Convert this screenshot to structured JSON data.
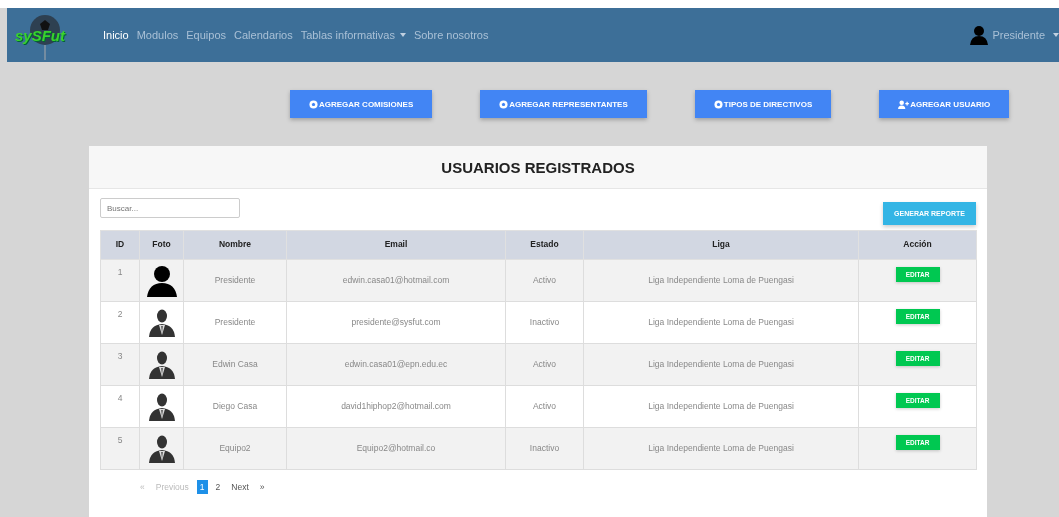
{
  "navbar": {
    "logo_text": "sySFut",
    "links": [
      {
        "label": "Inicio",
        "selected": true,
        "dropdown": false
      },
      {
        "label": "Modulos",
        "selected": false,
        "dropdown": false
      },
      {
        "label": "Equipos",
        "selected": false,
        "dropdown": false
      },
      {
        "label": "Calendarios",
        "selected": false,
        "dropdown": false
      },
      {
        "label": "Tablas informativas",
        "selected": false,
        "dropdown": true
      },
      {
        "label": "Sobre nosotros",
        "selected": false,
        "dropdown": false
      }
    ],
    "user": {
      "label": "Presidente"
    }
  },
  "actions": [
    {
      "label": "AGREGAR COMISIONES",
      "kind": "ball"
    },
    {
      "label": "AGREGAR REPRESENTANTES",
      "kind": "ball"
    },
    {
      "label": "TIPOS DE DIRECTIVOS",
      "kind": "ball"
    },
    {
      "label": "AGREGAR USUARIO",
      "kind": "adduser"
    }
  ],
  "card": {
    "title": "USUARIOS REGISTRADOS",
    "search": {
      "placeholder": "Buscar..."
    },
    "report_button": "GENERAR REPORTE",
    "table": {
      "columns": [
        "ID",
        "Foto",
        "Nombre",
        "Email",
        "Estado",
        "Liga",
        "Acción"
      ],
      "rows": [
        {
          "id": "1",
          "kind": "person",
          "name": "Presidente",
          "email": "edwin.casa01@hotmail.com",
          "status": "Activo",
          "league": "Liga Independiente Loma de Puengasi",
          "action": "EDITAR"
        },
        {
          "id": "2",
          "kind": "suit",
          "name": "Presidente",
          "email": "presidente@sysfut.com",
          "status": "Inactivo",
          "league": "Liga Independiente Loma de Puengasi",
          "action": "EDITAR"
        },
        {
          "id": "3",
          "kind": "suit",
          "name": "Edwin Casa",
          "email": "edwin.casa01@epn.edu.ec",
          "status": "Activo",
          "league": "Liga Independiente Loma de Puengasi",
          "action": "EDITAR"
        },
        {
          "id": "4",
          "kind": "suit",
          "name": "Diego Casa",
          "email": "david1hiphop2@hotmail.com",
          "status": "Activo",
          "league": "Liga Independiente Loma de Puengasi",
          "action": "EDITAR"
        },
        {
          "id": "5",
          "kind": "suit",
          "name": "Equipo2",
          "email": "Equipo2@hotmail.co",
          "status": "Inactivo",
          "league": "Liga Independiente Loma de Puengasi",
          "action": "EDITAR"
        }
      ]
    },
    "pagination": [
      {
        "label": "«",
        "selected": false,
        "disabled": true
      },
      {
        "label": "Previous",
        "selected": false,
        "disabled": true
      },
      {
        "label": "1",
        "selected": true,
        "disabled": false
      },
      {
        "label": "2",
        "selected": false,
        "disabled": false
      },
      {
        "label": "Next",
        "selected": false,
        "disabled": false
      },
      {
        "label": "»",
        "selected": false,
        "disabled": false
      }
    ]
  }
}
